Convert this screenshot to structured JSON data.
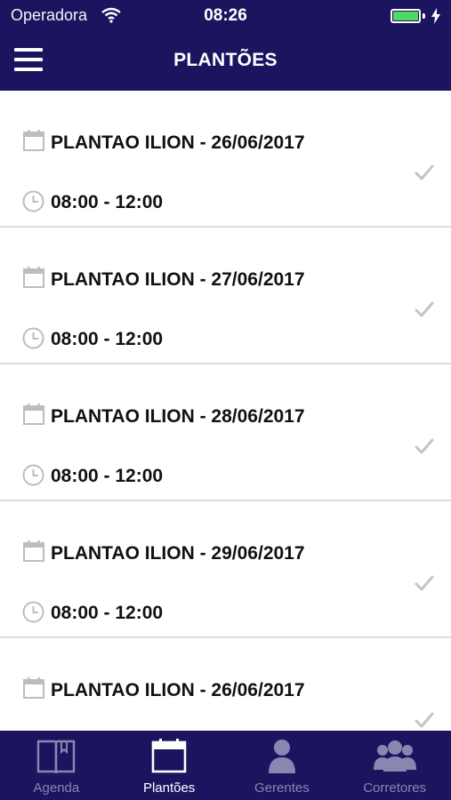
{
  "status_bar": {
    "carrier": "Operadora",
    "time": "08:26",
    "battery_level": 1.0,
    "icons": [
      "wifi-icon",
      "battery-icon",
      "charging-icon"
    ]
  },
  "nav_bar": {
    "title": "PLANTÕES",
    "menu_icon": "hamburger-menu-icon"
  },
  "shifts": [
    {
      "title": "PLANTAO ILION - 26/06/2017",
      "time": "08:00 - 12:00"
    },
    {
      "title": "PLANTAO ILION - 27/06/2017",
      "time": "08:00 - 12:00"
    },
    {
      "title": "PLANTAO ILION - 28/06/2017",
      "time": "08:00 - 12:00"
    },
    {
      "title": "PLANTAO ILION - 29/06/2017",
      "time": "08:00 - 12:00"
    },
    {
      "title": "PLANTAO ILION - 26/06/2017",
      "time": ""
    }
  ],
  "shift_icons": {
    "date": "calendar-icon",
    "time": "clock-icon",
    "status": "checkmark-icon"
  },
  "tabs": [
    {
      "label": "Agenda",
      "icon": "book-icon",
      "active": false
    },
    {
      "label": "Plantões",
      "icon": "calendar-icon",
      "active": true
    },
    {
      "label": "Gerentes",
      "icon": "person-icon",
      "active": false
    },
    {
      "label": "Corretores",
      "icon": "group-icon",
      "active": false
    }
  ],
  "colors": {
    "primary": "#1b1560",
    "active_tab": "#ffffff",
    "inactive_tab": "#8a86b0",
    "icon_gray": "#bdbdbd",
    "separator": "#dcdcdc",
    "battery": "#4cd964"
  }
}
